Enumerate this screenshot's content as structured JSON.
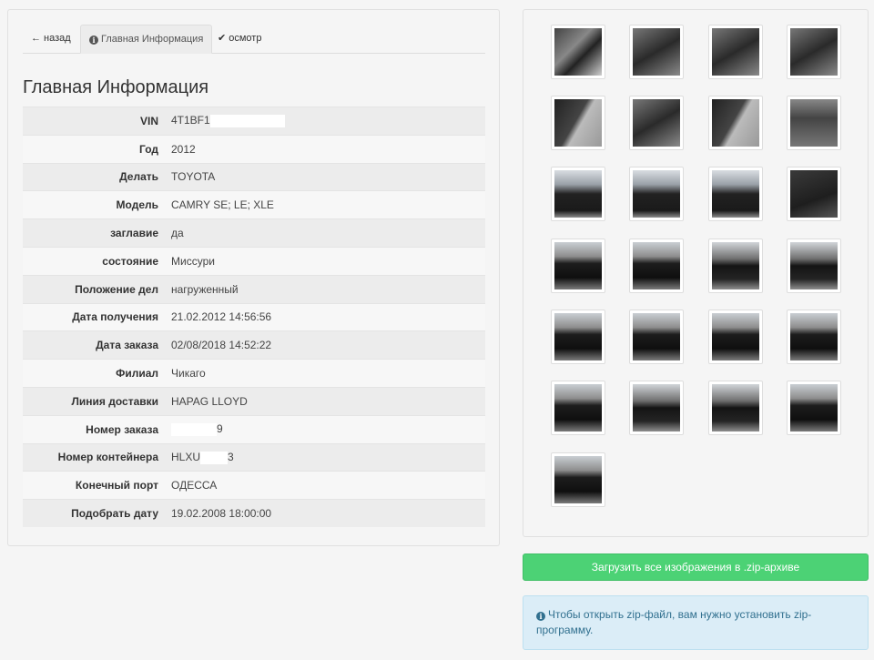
{
  "tabs": [
    {
      "label": "назад",
      "icon": "arrow-left-icon"
    },
    {
      "label": "Главная Информация",
      "icon": "info-circle-icon"
    },
    {
      "label": "осмотр",
      "icon": "check-icon"
    }
  ],
  "section_title": "Главная Информация",
  "details": [
    {
      "label": "VIN",
      "value": "4T1BF1",
      "redacted": true
    },
    {
      "label": "Год",
      "value": "2012"
    },
    {
      "label": "Делать",
      "value": "TOYOTA"
    },
    {
      "label": "Модель",
      "value": "CAMRY SE; LE; XLE"
    },
    {
      "label": "заглавие",
      "value": "да"
    },
    {
      "label": "состояние",
      "value": "Миссури"
    },
    {
      "label": "Положение дел",
      "value": "нагруженный"
    },
    {
      "label": "Дата получения",
      "value": "21.02.2012 14:56:56"
    },
    {
      "label": "Дата заказа",
      "value": "02/08/2018 14:52:22"
    },
    {
      "label": "Филиал",
      "value": "Чикаго"
    },
    {
      "label": "Линия доставки",
      "value": "HAPAG LLOYD"
    },
    {
      "label": "Номер заказа",
      "value_suffix": "9",
      "redacted": true
    },
    {
      "label": "Номер контейнера",
      "value_prefix": "HLXU",
      "value_suffix": "3",
      "redacted": true
    },
    {
      "label": "Конечный порт",
      "value": "ОДЕССА"
    },
    {
      "label": "Подобрать дату",
      "value": "19.02.2008 18:00:00"
    }
  ],
  "gallery": {
    "photo_count": 25,
    "photos": [
      "fuse",
      "interior",
      "interior",
      "interior",
      "door",
      "interior",
      "door",
      "trunk",
      "roof",
      "roof",
      "roof",
      "dark",
      "car",
      "car",
      "carside",
      "carside",
      "car",
      "car",
      "car",
      "car",
      "car",
      "carside",
      "carside",
      "car",
      "car"
    ]
  },
  "download_button": "Загрузить все изображения в .zip-архиве",
  "zip_notice": "Чтобы открыть zip-файл, вам нужно установить zip-программу.",
  "colors": {
    "download_button": "#4cd275",
    "notice_background": "#dbedf7",
    "notice_text": "#31708f"
  }
}
